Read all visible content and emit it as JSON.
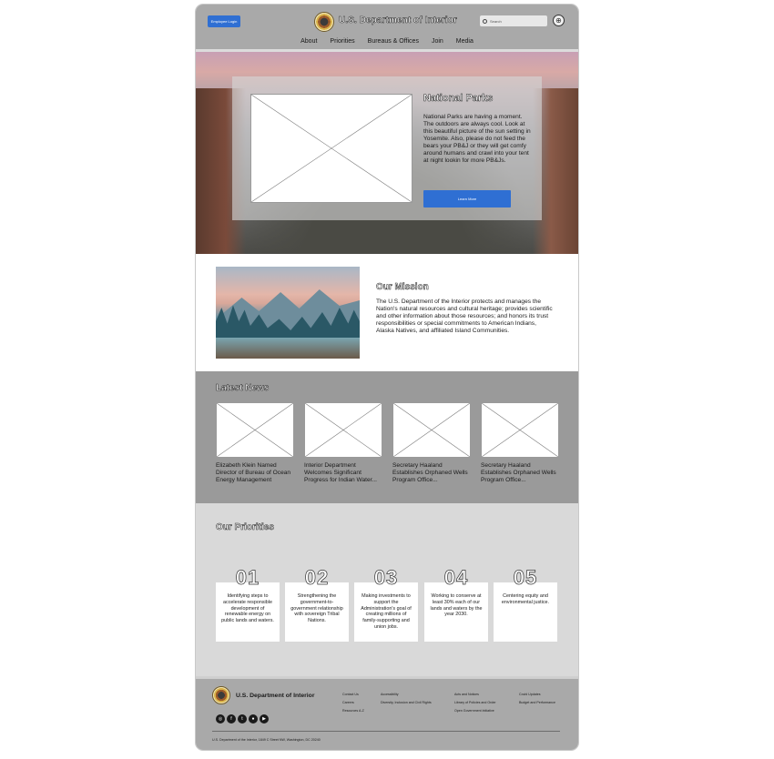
{
  "header": {
    "login_label": "Employee Login",
    "brand": "U.S. Department of Interior",
    "search_placeholder": "Search",
    "nav": [
      "About",
      "Priorities",
      "Bureaus & Offices",
      "Join",
      "Media"
    ]
  },
  "hero": {
    "title": "National Parks",
    "body": "National Parks are having a moment. The outdoors are always cool. Look at this beautiful picture of the sun setting in Yosemite. Also, please do not feed the bears your PB&J or they will get comfy around humans and crawl into your tent at night lookin for more PB&Js.",
    "button": "Learn More"
  },
  "mission": {
    "title": "Our Mission",
    "body": "The U.S. Department of the Interior protects and manages the Nation's natural resources and cultural heritage; provides scientific and other information about those resources; and honors its trust responsibilities or special commitments to American Indians, Alaska Natives, and affiliated Island Communities."
  },
  "news": {
    "title": "Latest News",
    "items": [
      "Elizabeth Klein Named Director of Bureau of Ocean Energy Management",
      "Interior Department Welcomes Significant Progress for Indian Water...",
      "Secretary Haaland Establishes Orphaned Wells Program Office...",
      "Secretary Haaland Establishes Orphaned Wells Program Office..."
    ]
  },
  "priorities": {
    "title": "Our Priorities",
    "items": [
      {
        "num": "01",
        "text": "Identifying steps to accelerate responsible development of renewable energy on public lands and waters."
      },
      {
        "num": "02",
        "text": "Strengthening the government-to-government relationship with sovereign Tribal Nations."
      },
      {
        "num": "03",
        "text": "Making investments to support the Administration's goal of creating millions of family-supporting and union jobs."
      },
      {
        "num": "04",
        "text": "Working to conserve at least 30% each of our lands and waters by the year 2030."
      },
      {
        "num": "05",
        "text": "Centering equity and environmental justice."
      }
    ]
  },
  "footer": {
    "brand": "U.S. Department of Interior",
    "socials": [
      "instagram-icon",
      "facebook-icon",
      "twitter-icon",
      "flickr-icon",
      "youtube-icon"
    ],
    "col1": [
      "Contact Us",
      "Careers",
      "Resources A-Z"
    ],
    "col2": [
      "Accessibility",
      "Diversity, Inclusion and Civil Rights"
    ],
    "col3": [
      "Acts and Notices",
      "Library of Policies and Order",
      "Open Government Initiative"
    ],
    "col4": [
      "Covid Updates",
      "Budget and Performance"
    ],
    "address": "U.S. Department of the Interior, 1849 C Street NW, Washington, DC 20240"
  }
}
